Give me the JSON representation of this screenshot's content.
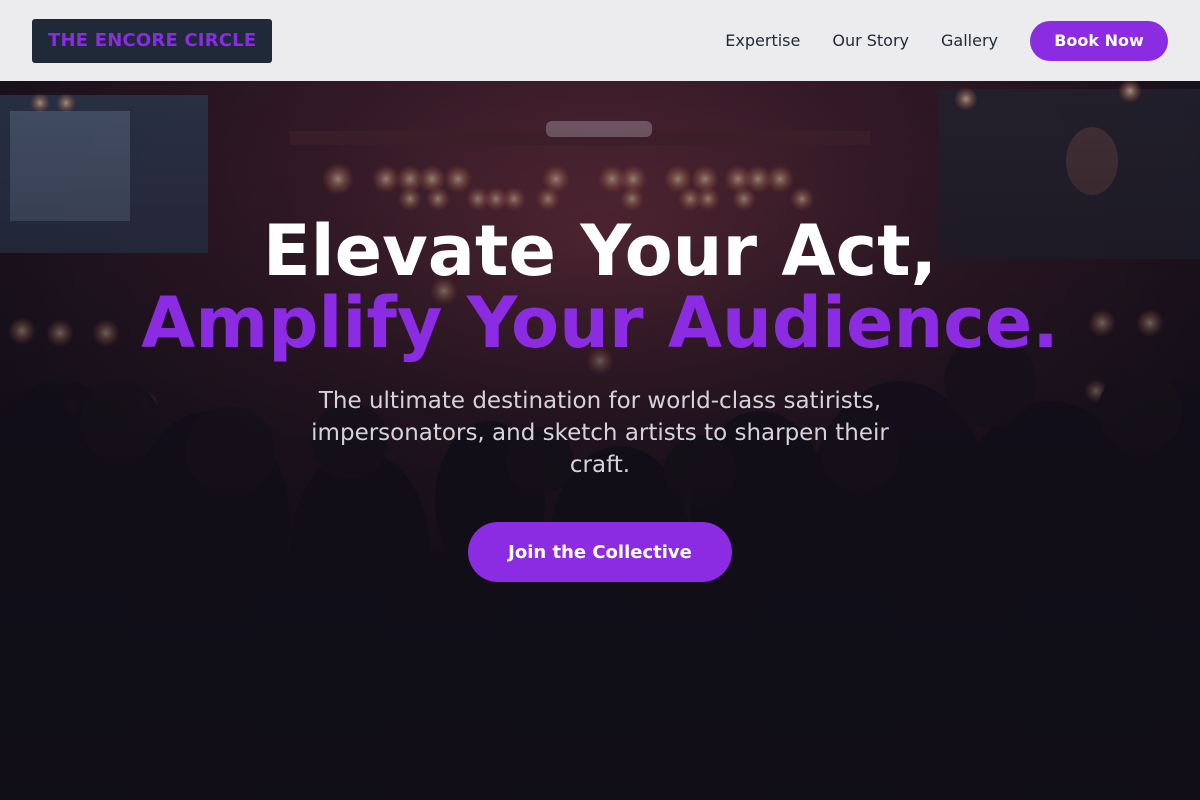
{
  "brand": {
    "name": "THE ENCORE CIRCLE"
  },
  "nav": {
    "links": [
      "Expertise",
      "Our Story",
      "Gallery"
    ],
    "cta_label": "Book Now"
  },
  "hero": {
    "title_line1": "Elevate Your Act,",
    "title_line2": "Amplify Your Audience.",
    "subtitle": "The ultimate destination for world-class satirists, impersonators, and sketch artists to sharpen their craft.",
    "cta_label": "Join the Collective",
    "background_image": "concert-crowd-stage-lights"
  },
  "colors": {
    "accent": "#8b2be2",
    "header_bg": "#ececee",
    "logo_bg": "#1f2937",
    "text_dark": "#1f2937",
    "hero_overlay": "#0f0d16"
  }
}
